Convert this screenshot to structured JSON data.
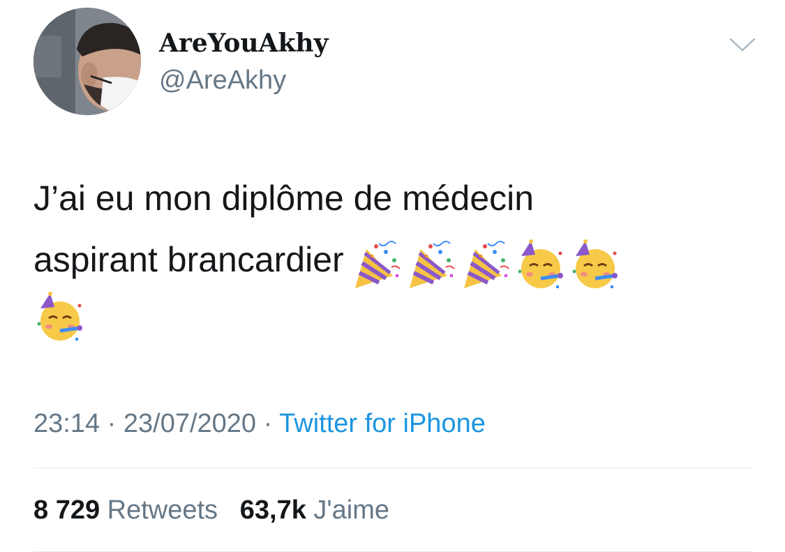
{
  "tweet": {
    "author": {
      "display_name": "AreYouAkhy",
      "handle": "@AreAkhy",
      "avatar_icon": "profile-photo"
    },
    "text": "J’ai eu mon diplôme de médecin aspirant brancardier",
    "text_line1": "J’ai eu mon diplôme de médecin",
    "text_line2": "aspirant brancardier",
    "emojis": [
      "party-popper",
      "party-popper",
      "party-popper",
      "partying-face",
      "partying-face",
      "partying-face"
    ],
    "time": "23:14",
    "date": "23/07/2020",
    "separator": "·",
    "source": "Twitter for iPhone",
    "stats": {
      "retweets_count": "8 729",
      "retweets_label": "Retweets",
      "likes_count": "63,7k",
      "likes_label": "J'aime"
    }
  },
  "colors": {
    "text_primary": "#14171a",
    "text_secondary": "#657786",
    "link": "#1b95e0",
    "divider": "#e1e8ed"
  }
}
